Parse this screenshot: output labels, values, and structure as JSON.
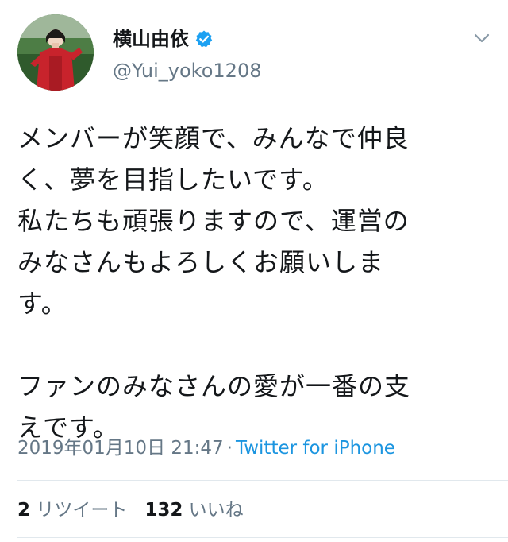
{
  "tweet": {
    "author": {
      "display_name": "横山由依",
      "handle": "@Yui_yoko1208",
      "verified": true,
      "avatar_icon": "user-avatar-photo",
      "verified_icon": "verified-badge-icon",
      "accent_color": "#1da1f2"
    },
    "menu_icon": "chevron-down-icon",
    "text_lines": [
      "メンバーが笑顔で、みんなで仲良",
      "く、夢を目指したいです。",
      "私たちも頑張りますので、運営の",
      "みなさんもよろしくお願いしま",
      "す。",
      "",
      "ファンのみなさんの愛が一番の支",
      "えです。"
    ],
    "timestamp": "2019年01月10日 21:47",
    "separator": "·",
    "source": "Twitter for iPhone",
    "stats": {
      "retweets_count": "2",
      "retweets_label": "リツイート",
      "likes_count": "132",
      "likes_label": "いいね"
    }
  }
}
